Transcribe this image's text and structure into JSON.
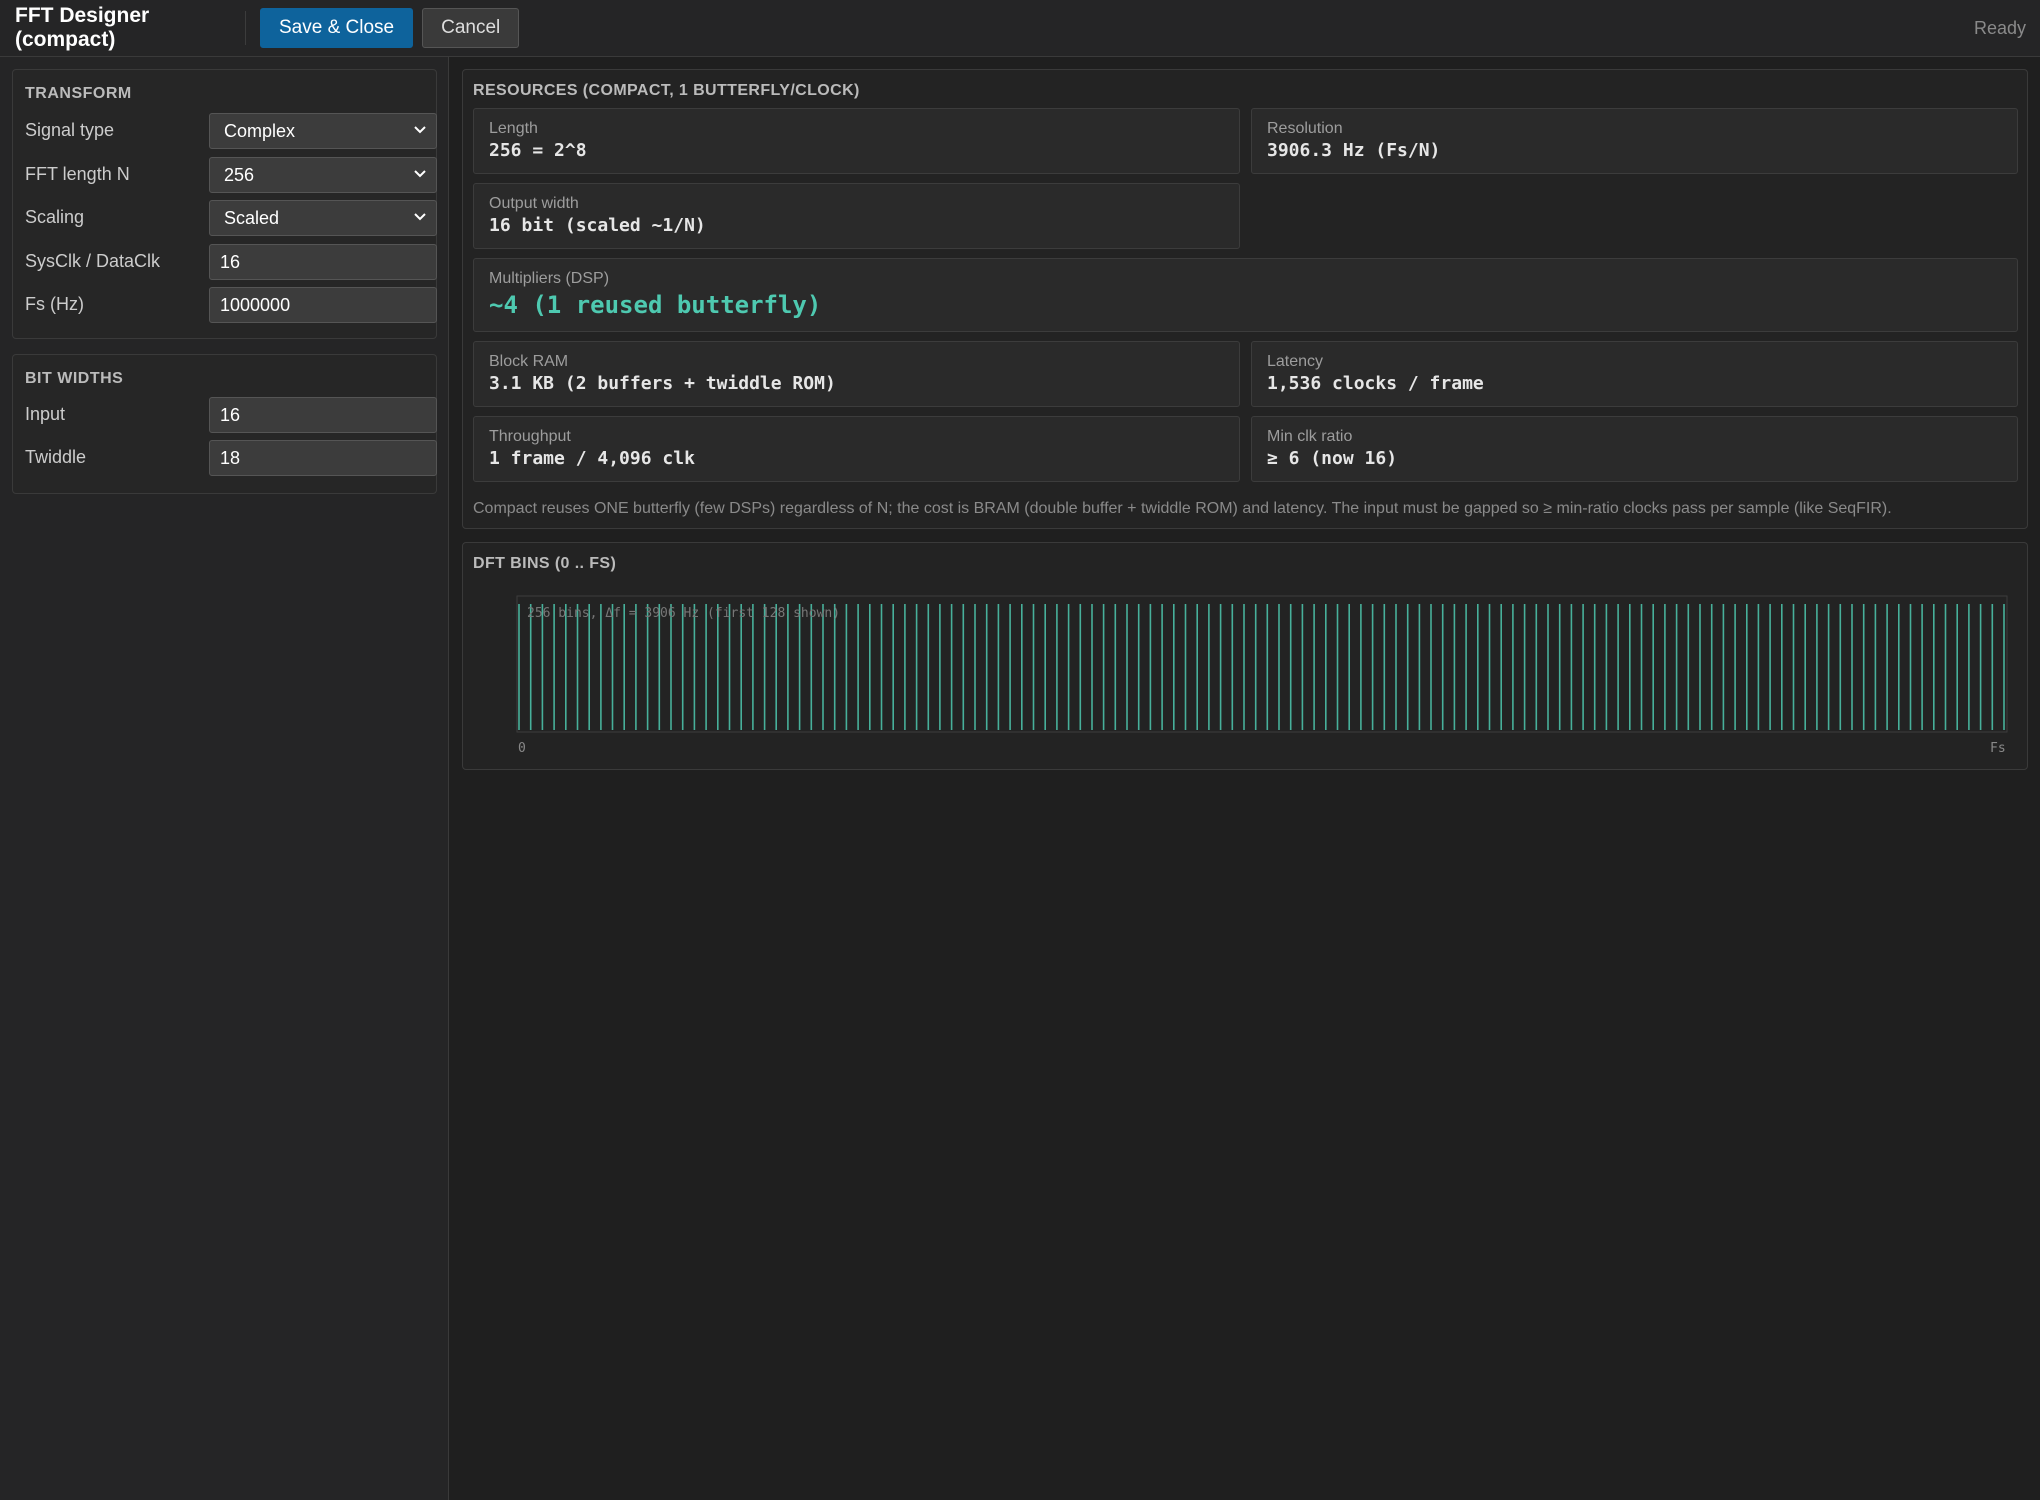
{
  "app": {
    "title": "FFT Designer (compact)",
    "save_label": "Save & Close",
    "cancel_label": "Cancel",
    "status": "Ready"
  },
  "transform": {
    "title": "TRANSFORM",
    "signal_type": {
      "label": "Signal type",
      "value": "Complex"
    },
    "fft_length": {
      "label": "FFT length N",
      "value": "256"
    },
    "scaling": {
      "label": "Scaling",
      "value": "Scaled"
    },
    "sysclk": {
      "label": "SysClk / DataClk",
      "value": "16"
    },
    "fs": {
      "label": "Fs (Hz)",
      "value": "1000000"
    }
  },
  "bit_widths": {
    "title": "BIT WIDTHS",
    "input": {
      "label": "Input",
      "value": "16"
    },
    "twiddle": {
      "label": "Twiddle",
      "value": "18"
    }
  },
  "resources": {
    "title": "RESOURCES (COMPACT, 1 BUTTERFLY/CLOCK)",
    "length": {
      "label": "Length",
      "value": "256 = 2^8"
    },
    "resolution": {
      "label": "Resolution",
      "value": "3906.3 Hz (Fs/N)"
    },
    "output_width": {
      "label": "Output width",
      "value": "16 bit (scaled ~1/N)"
    },
    "multipliers": {
      "label": "Multipliers (DSP)",
      "value": "~4 (1 reused butterfly)"
    },
    "block_ram": {
      "label": "Block RAM",
      "value": "3.1 KB (2 buffers + twiddle ROM)"
    },
    "latency": {
      "label": "Latency",
      "value": "1,536 clocks / frame"
    },
    "throughput": {
      "label": "Throughput",
      "value": "1 frame / 4,096 clk"
    },
    "min_clk_ratio": {
      "label": "Min clk ratio",
      "value": "≥ 6 (now 16)"
    },
    "note": "Compact reuses ONE butterfly (few DSPs) regardless of N; the cost is BRAM (double buffer + twiddle ROM) and latency. The input must be gapped so ≥ min-ratio clocks pass per sample (like SeqFIR)."
  },
  "dft": {
    "title": "DFT BINS (0 .. FS)"
  },
  "colors": {
    "accent": "#4ec9b0",
    "primary_button": "#0e639c",
    "background": "#1f1f1f"
  },
  "chart_data": {
    "type": "bar",
    "title": "256 bins, Δf = 3906 Hz  (first 128 shown)",
    "x_tick_labels": [
      "0",
      "Fs"
    ],
    "bin_count_shown": 128,
    "bin_values": 1
  }
}
